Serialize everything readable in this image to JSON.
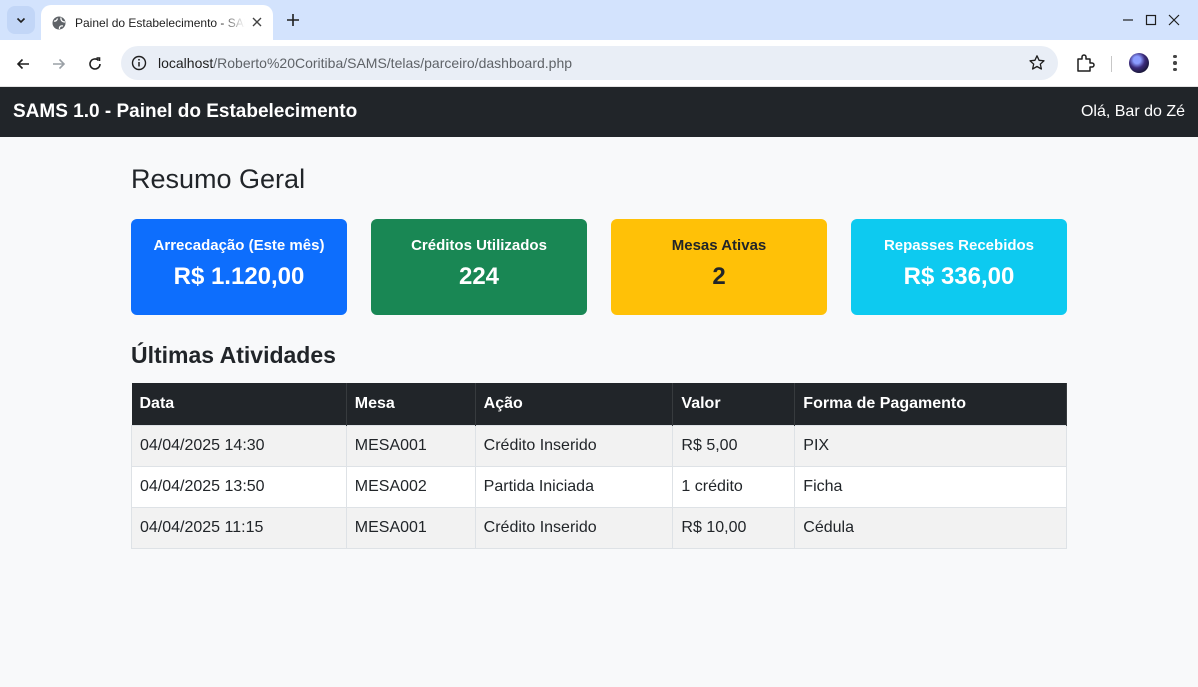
{
  "browser": {
    "tab_title": "Painel do Estabelecimento - SAMS",
    "url_host": "localhost",
    "url_path": "/Roberto%20Coritiba/SAMS/telas/parceiro/dashboard.php"
  },
  "navbar": {
    "brand": "SAMS 1.0 - Painel do Estabelecimento",
    "greeting": "Olá, Bar do Zé"
  },
  "summary": {
    "heading": "Resumo Geral",
    "cards": [
      {
        "title": "Arrecadação (Este mês)",
        "value": "R$ 1.120,00",
        "bg": "#0d6efd",
        "fg": "#ffffff"
      },
      {
        "title": "Créditos Utilizados",
        "value": "224",
        "bg": "#198754",
        "fg": "#ffffff"
      },
      {
        "title": "Mesas Ativas",
        "value": "2",
        "bg": "#ffc107",
        "fg": "#212529"
      },
      {
        "title": "Repasses Recebidos",
        "value": "R$ 336,00",
        "bg": "#0dcaf0",
        "fg": "#ffffff"
      }
    ]
  },
  "activities": {
    "heading": "Últimas Atividades",
    "columns": [
      "Data",
      "Mesa",
      "Ação",
      "Valor",
      "Forma de Pagamento"
    ],
    "rows": [
      [
        "04/04/2025 14:30",
        "MESA001",
        "Crédito Inserido",
        "R$ 5,00",
        "PIX"
      ],
      [
        "04/04/2025 13:50",
        "MESA002",
        "Partida Iniciada",
        "1 crédito",
        "Ficha"
      ],
      [
        "04/04/2025 11:15",
        "MESA001",
        "Crédito Inserido",
        "R$ 10,00",
        "Cédula"
      ]
    ]
  }
}
